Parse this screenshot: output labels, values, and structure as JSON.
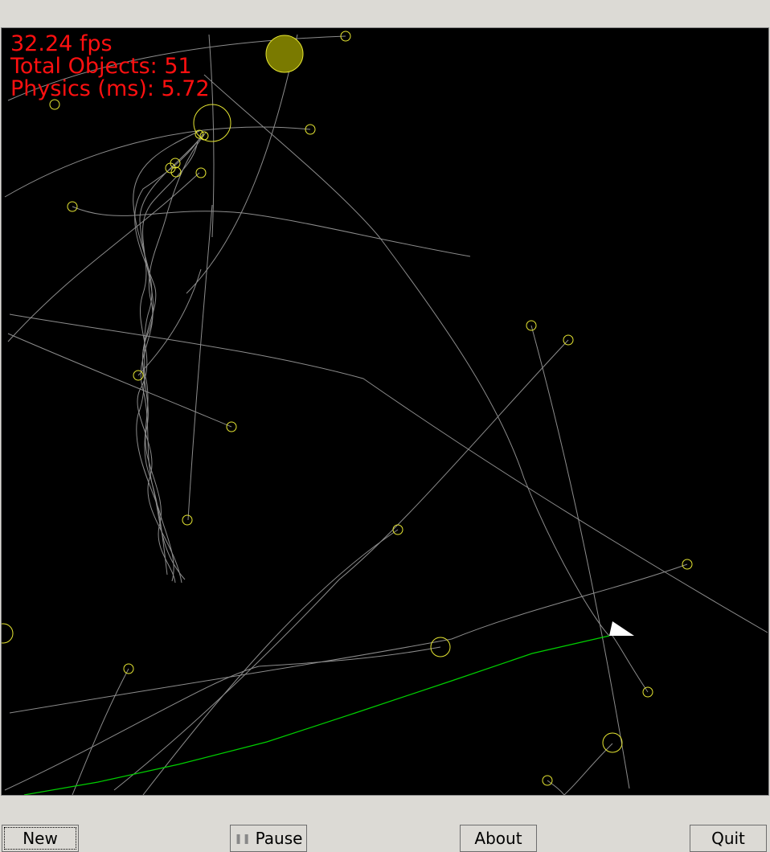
{
  "hud": {
    "fps_text": "32.24 fps",
    "objects_text": "Total Objects: 51",
    "physics_text": "Physics (ms): 5.72"
  },
  "colors": {
    "background": "#000000",
    "trail": "#8c8c8c",
    "body_outline": "#e6e632",
    "player_trail": "#00d000",
    "ship": "#ffffff",
    "hud_text": "#ff1010"
  },
  "buttons": {
    "new_label": "New",
    "pause_label": "Pause",
    "about_label": "About",
    "quit_label": "Quit"
  },
  "icons": {
    "pause": "pause-icon",
    "ship": "ship-icon"
  }
}
